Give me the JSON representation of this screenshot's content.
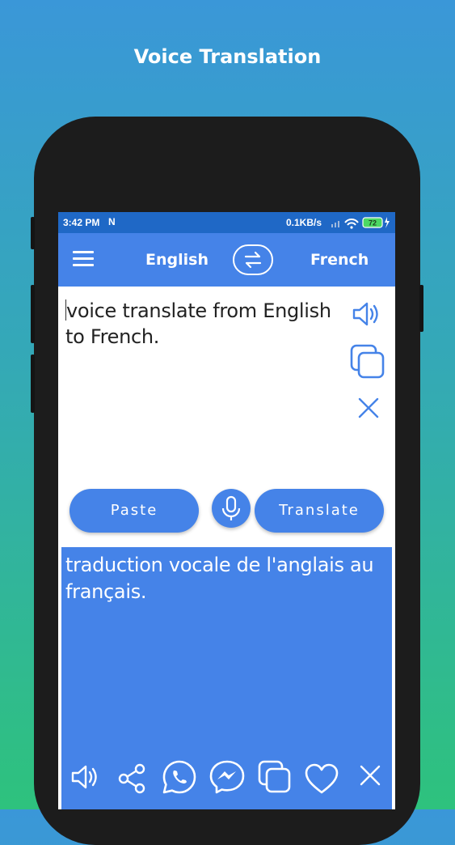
{
  "promo_title": "Voice Translation",
  "status_bar": {
    "time": "3:42 PM",
    "notification": "N",
    "speed": "0.1KB/s",
    "battery": "72"
  },
  "app_bar": {
    "source_language": "English",
    "target_language": "French"
  },
  "input": {
    "text": "voice translate from English to French.",
    "paste_label": "Paste",
    "translate_label": "Translate"
  },
  "output": {
    "text": "traduction vocale de l'anglais au français."
  },
  "icons": {
    "menu": "menu-icon",
    "swap": "swap-icon",
    "speaker": "speaker-icon",
    "copy": "copy-icon",
    "clear": "close-icon",
    "mic": "mic-icon",
    "bottom": [
      "speaker-icon",
      "share-icon",
      "whatsapp-icon",
      "messenger-icon",
      "copy-icon",
      "heart-icon",
      "close-icon"
    ]
  },
  "colors": {
    "accent": "#4583e8",
    "status_bar": "#1f68c6",
    "phone_frame": "#1c1c1c"
  }
}
